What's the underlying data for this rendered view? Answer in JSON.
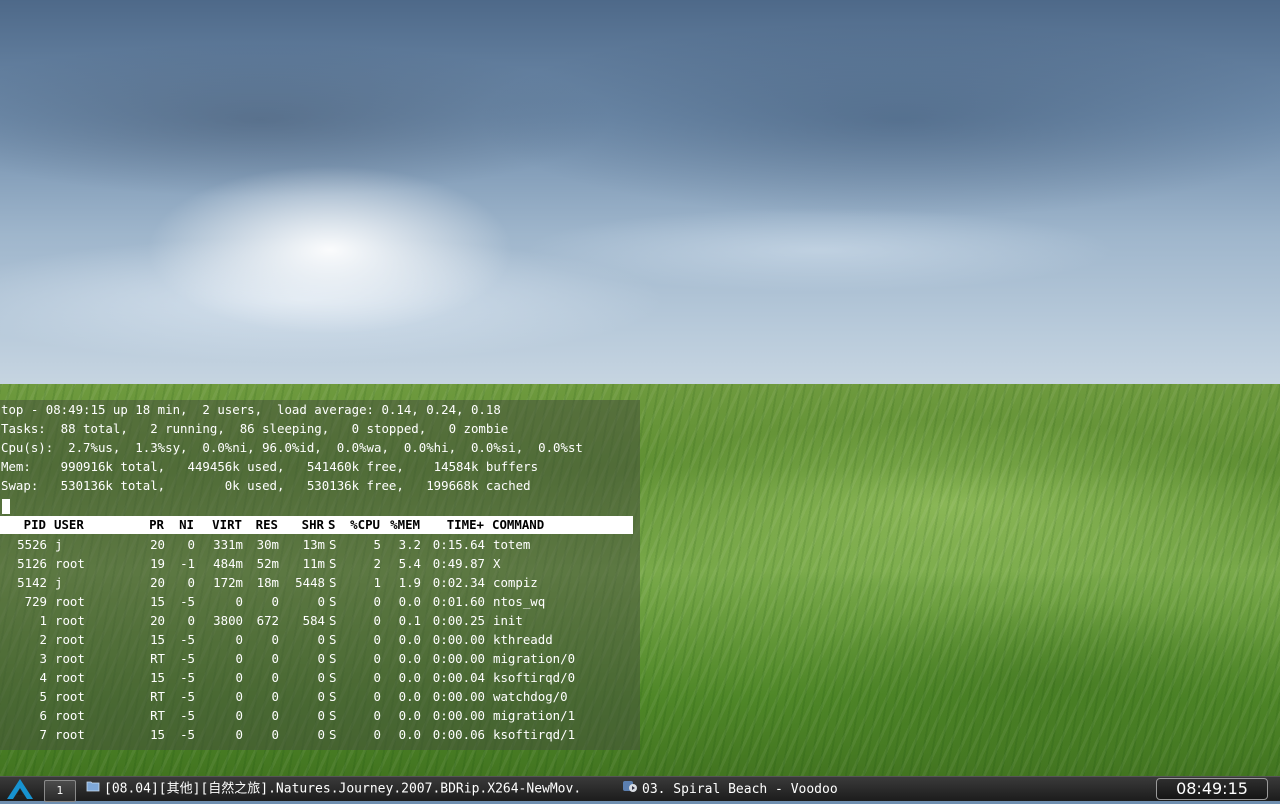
{
  "top": {
    "summary": [
      "top - 08:49:15 up 18 min,  2 users,  load average: 0.14, 0.24, 0.18",
      "Tasks:  88 total,   2 running,  86 sleeping,   0 stopped,   0 zombie",
      "Cpu(s):  2.7%us,  1.3%sy,  0.0%ni, 96.0%id,  0.0%wa,  0.0%hi,  0.0%si,  0.0%st",
      "Mem:    990916k total,   449456k used,   541460k free,    14584k buffers",
      "Swap:   530136k total,        0k used,   530136k free,   199668k cached"
    ],
    "columns": [
      "PID",
      "USER",
      "PR",
      "NI",
      "VIRT",
      "RES",
      "SHR",
      "S",
      "%CPU",
      "%MEM",
      "TIME+",
      "COMMAND"
    ],
    "processes": [
      [
        "5526",
        "j",
        "20",
        "0",
        "331m",
        "30m",
        "13m",
        "S",
        "5",
        "3.2",
        "0:15.64",
        "totem"
      ],
      [
        "5126",
        "root",
        "19",
        "-1",
        "484m",
        "52m",
        "11m",
        "S",
        "2",
        "5.4",
        "0:49.87",
        "X"
      ],
      [
        "5142",
        "j",
        "20",
        "0",
        "172m",
        "18m",
        "5448",
        "S",
        "1",
        "1.9",
        "0:02.34",
        "compiz"
      ],
      [
        "729",
        "root",
        "15",
        "-5",
        "0",
        "0",
        "0",
        "S",
        "0",
        "0.0",
        "0:01.60",
        "ntos_wq"
      ],
      [
        "1",
        "root",
        "20",
        "0",
        "3800",
        "672",
        "584",
        "S",
        "0",
        "0.1",
        "0:00.25",
        "init"
      ],
      [
        "2",
        "root",
        "15",
        "-5",
        "0",
        "0",
        "0",
        "S",
        "0",
        "0.0",
        "0:00.00",
        "kthreadd"
      ],
      [
        "3",
        "root",
        "RT",
        "-5",
        "0",
        "0",
        "0",
        "S",
        "0",
        "0.0",
        "0:00.00",
        "migration/0"
      ],
      [
        "4",
        "root",
        "15",
        "-5",
        "0",
        "0",
        "0",
        "S",
        "0",
        "0.0",
        "0:00.04",
        "ksoftirqd/0"
      ],
      [
        "5",
        "root",
        "RT",
        "-5",
        "0",
        "0",
        "0",
        "S",
        "0",
        "0.0",
        "0:00.00",
        "watchdog/0"
      ],
      [
        "6",
        "root",
        "RT",
        "-5",
        "0",
        "0",
        "0",
        "S",
        "0",
        "0.0",
        "0:00.00",
        "migration/1"
      ],
      [
        "7",
        "root",
        "15",
        "-5",
        "0",
        "0",
        "0",
        "S",
        "0",
        "0.0",
        "0:00.06",
        "ksoftirqd/1"
      ]
    ]
  },
  "panel": {
    "menu_icon": "arch-linux-logo-icon",
    "pager_label": "1",
    "tasks": [
      {
        "icon": "folder-icon",
        "label": "[08.04][其他][自然之旅].Natures.Journey.2007.BDRip.X264-NewMov."
      },
      {
        "icon": "media-player-icon",
        "label": "03. Spiral Beach - Voodoo"
      }
    ],
    "clock": "08:49:15"
  },
  "colors": {
    "terminal_text": "#ffffff",
    "terminal_header_bg": "#ffffff",
    "terminal_header_text": "#000000",
    "panel_bg": "#1c1c1c",
    "menu_logo": "#1793d1"
  }
}
